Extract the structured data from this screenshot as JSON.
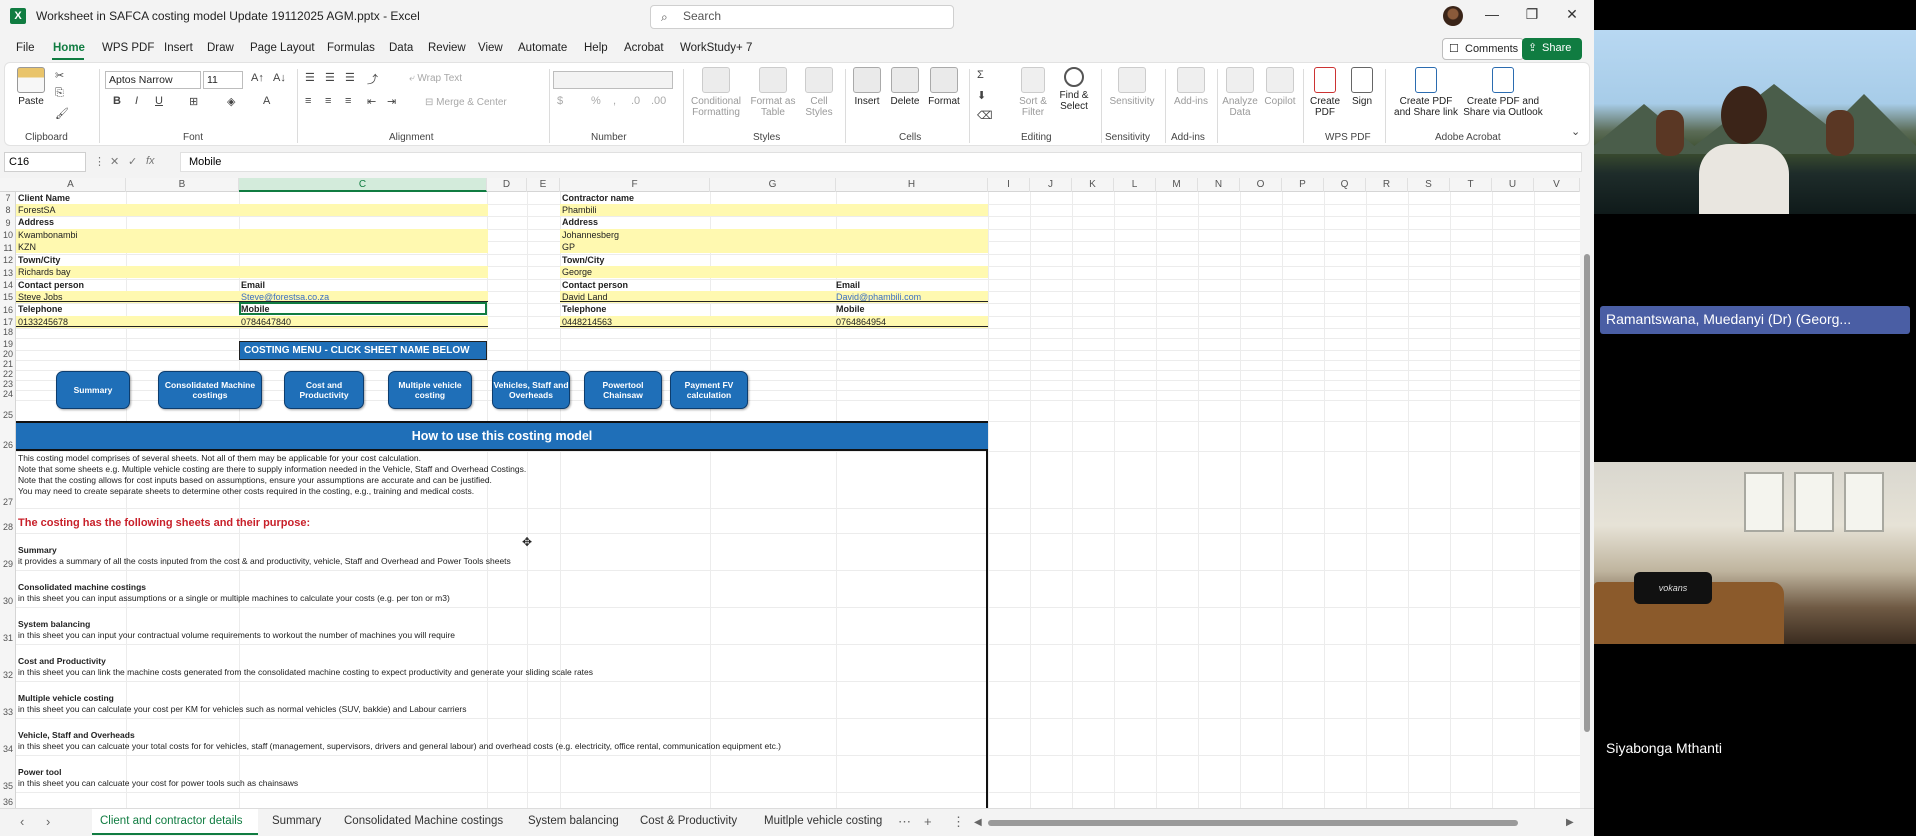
{
  "window": {
    "title": "Worksheet in SAFCA costing model Update 19112025 AGM.pptx  -  Excel",
    "search_placeholder": "Search",
    "app_icon": "X"
  },
  "menu": {
    "items": [
      "File",
      "Home",
      "WPS PDF",
      "Insert",
      "Draw",
      "Page Layout",
      "Formulas",
      "Data",
      "Review",
      "View",
      "Automate",
      "Help",
      "Acrobat",
      "WorkStudy+ 7"
    ],
    "active": "Home",
    "comments_label": "Comments",
    "share_label": "Share"
  },
  "ribbon": {
    "font_name": "Aptos Narrow",
    "font_size": "11",
    "wrap_text": "Wrap Text",
    "merge_center": "Merge & Center",
    "paste": "Paste",
    "groups": [
      "Clipboard",
      "Font",
      "Alignment",
      "Number",
      "Styles",
      "Cells",
      "Editing",
      "Sensitivity",
      "Add-ins",
      "WPS PDF",
      "Adobe Acrobat"
    ],
    "styles": [
      "Conditional Formatting",
      "Format as Table",
      "Cell Styles"
    ],
    "cells": [
      "Insert",
      "Delete",
      "Format"
    ],
    "editing": [
      "Sort & Filter",
      "Find & Select"
    ],
    "sensitivity": "Sensitivity",
    "addins": "Add-ins",
    "analyze": "Analyze Data",
    "copilot": "Copilot",
    "wps": [
      "Create PDF",
      "Sign"
    ],
    "acrobat": [
      "Create PDF and Share link",
      "Create PDF and Share via Outlook"
    ]
  },
  "formula_bar": {
    "name_box": "C16",
    "content": "Mobile"
  },
  "columns": [
    "A",
    "B",
    "C",
    "D",
    "E",
    "F",
    "G",
    "H",
    "I",
    "J",
    "K",
    "L",
    "M",
    "N",
    "O",
    "P",
    "Q",
    "R",
    "S",
    "T",
    "U",
    "V"
  ],
  "selected_column": "C",
  "rows": [
    "7",
    "8",
    "9",
    "10",
    "11",
    "12",
    "13",
    "14",
    "15",
    "16",
    "17",
    "18",
    "19",
    "20",
    "21",
    "22",
    "23",
    "24",
    "25",
    "26",
    "27",
    "28",
    "29",
    "30",
    "31",
    "32",
    "33",
    "34",
    "35",
    "36"
  ],
  "client": {
    "name_label": "Client Name",
    "name": "ForestSA",
    "address_label": "Address",
    "address1": "Kwambonambi",
    "address2": "KZN",
    "town_label": "Town/City",
    "town": "Richards bay",
    "contact_label": "Contact person",
    "contact": "Steve Jobs",
    "email_label": "Email",
    "email": "Steve@forestsa.co.za",
    "tel_label": "Telephone",
    "tel": "0133245678",
    "mobile_label": "Mobile",
    "mobile": "0784647840"
  },
  "contractor": {
    "name_label": "Contractor name",
    "name": "Phambili",
    "address_label": "Address",
    "address1": "Johannesberg",
    "address2": "GP",
    "town_label": "Town/City",
    "town": "George",
    "contact_label": "Contact person",
    "contact": "David Land",
    "email_label": "Email",
    "email": "David@phambili.com",
    "tel_label": "Telephone",
    "tel": "0448214563",
    "mobile_label": "Mobile",
    "mobile": "0764864954"
  },
  "costing_menu": "COSTING MENU - CLICK SHEET NAME BELOW",
  "nav_buttons": [
    "Summary",
    "Consolidated Machine costings",
    "Cost and Productivity",
    "Multiple vehicle costing",
    "Vehicles, Staff and Overheads",
    "Powertool Chainsaw",
    "Payment FV calculation"
  ],
  "howto": {
    "title": "How to use this costing model",
    "intro": [
      "This costing model comprises of several sheets. Not all of them may be applicable for your cost calculation.",
      "Note that some sheets e.g. Multiple vehicle costing are there to supply information needed in the Vehicle, Staff and Overhead Costings.",
      "Note that the costing allows for cost inputs based on assumptions, ensure your assumptions are accurate and can be justified.",
      "You may need to create separate sheets to determine other costs required in the costing, e.g., training and medical costs."
    ],
    "purpose_heading": "The costing has the following sheets and their purpose:",
    "sheets": [
      {
        "name": "Summary",
        "desc": "it provides a summary of all the costs inputed from the cost & and productivity, vehicle, Staff and Overhead and Power Tools sheets"
      },
      {
        "name": "Consolidated machine costings",
        "desc": "in this sheet you can input assumptions or a single or multiple machines to calculate your costs (e.g. per ton or m3)"
      },
      {
        "name": "System balancing",
        "desc": "in this sheet you can input your contractual volume requirements to workout the number of machines you will require"
      },
      {
        "name": "Cost and Productivity",
        "desc": "in this sheet you can link the machine costs generated from the consolidated machine costing to expect productivity and generate your sliding scale rates"
      },
      {
        "name": "Multiple vehicle costing",
        "desc": "in this sheet you can calculate your cost per KM for vehicles such as normal vehicles (SUV, bakkie) and Labour carriers"
      },
      {
        "name": "Vehicle, Staff and Overheads",
        "desc": "in this sheet you can calcuate your total costs for for vehicles, staff (management, supervisors, drivers and general labour) and overhead costs (e.g. electricity, office rental, communication equipment etc.)"
      },
      {
        "name": "Power tool",
        "desc": "in this sheet you can calcuate your cost for power tools such as chainsaws"
      }
    ]
  },
  "sheet_tabs": [
    "Client and contractor details",
    "Summary",
    "Consolidated Machine costings",
    "System balancing",
    "Cost & Productivity",
    "Muitlple vehicle costing"
  ],
  "active_sheet": "Client and contractor details",
  "meeting": {
    "participant1": "Ramantswana, Muedanyi (Dr) (Georg...",
    "participant2": "Siyabonga Mthanti",
    "room_device": "vokans"
  },
  "colors": {
    "excel_green": "#107c41",
    "banner_blue": "#1f6fb8",
    "yellow_fill": "#fff9b0",
    "purpose_red": "#c8202a"
  }
}
